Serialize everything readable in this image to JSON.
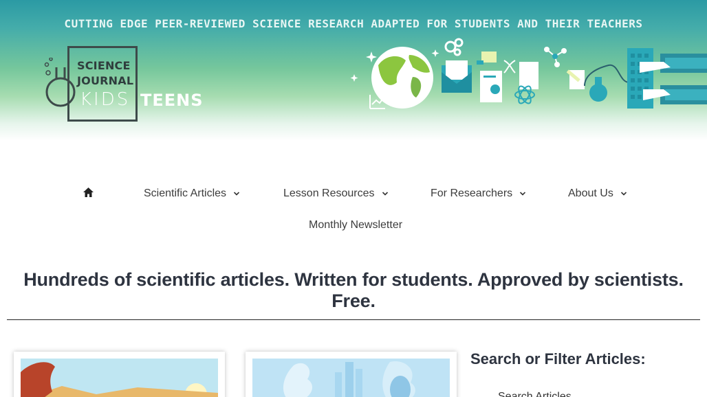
{
  "header": {
    "tagline": "CUTTING EDGE PEER-REVIEWED SCIENCE RESEARCH ADAPTED FOR STUDENTS AND THEIR TEACHERS",
    "logo": {
      "line1": "SCIENCE",
      "line2": "JOURNAL",
      "line3": "KIDS",
      "line4": "TEENS"
    }
  },
  "nav": {
    "items": [
      {
        "label": "Scientific Articles"
      },
      {
        "label": "Lesson Resources"
      },
      {
        "label": "For Researchers"
      },
      {
        "label": "About Us"
      },
      {
        "label": "Monthly Newsletter"
      }
    ]
  },
  "main": {
    "headline": "Hundreds of scientific articles. Written for students. Approved by scientists. Free."
  },
  "sidebar": {
    "title": "Search or Filter Articles:",
    "search_link": "Search Articles"
  },
  "colors": {
    "header_top": "#2b9aa4",
    "header_mid": "#76c79c",
    "text_dark": "#2e3440",
    "accent_teal": "#2aa8b8"
  }
}
